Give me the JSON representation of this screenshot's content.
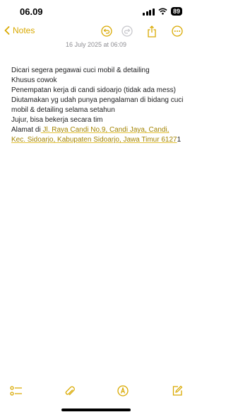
{
  "status": {
    "time": "06.09",
    "battery": "89"
  },
  "toolbar": {
    "back_label": "Notes"
  },
  "note": {
    "date": "16 July 2025 at 06:09",
    "lines": [
      "Dicari segera pegawai cuci mobil & detailing",
      "Khusus cowok",
      "Penempatan kerja di candi sidoarjo (tidak ada mess)",
      "Diutamakan yg udah punya pengalaman di bidang cuci mobil & detailing selama setahun",
      "Jujur, bisa bekerja secara tim"
    ],
    "address_prefix": "Alamat di",
    "address_link": " Jl. Raya Candi No.9, Candi Jaya, Candi, Kec. Sidoarjo, Kabupaten Sidoarjo, Jawa Timur 6127",
    "address_suffix": "1"
  },
  "colors": {
    "accent": "#d9a900",
    "link": "#a38300"
  },
  "icons": [
    "back-chevron-icon",
    "undo-icon",
    "redo-icon",
    "share-icon",
    "more-icon",
    "checklist-icon",
    "attachment-icon",
    "markup-icon",
    "compose-icon"
  ]
}
